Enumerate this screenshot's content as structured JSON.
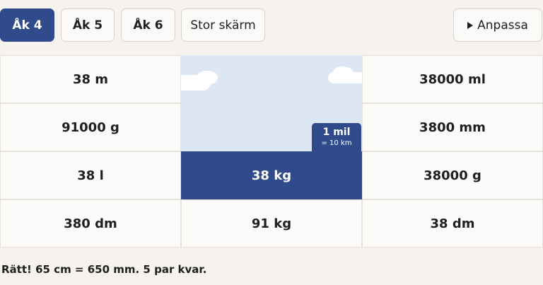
{
  "toolbar": {
    "grades": [
      {
        "label": "Åk 4",
        "active": true
      },
      {
        "label": "Åk 5",
        "active": false
      },
      {
        "label": "Åk 6",
        "active": false
      }
    ],
    "big_screen_label": "Stor skärm",
    "customize_label": "Anpassa"
  },
  "grid": {
    "col1": [
      "38 m",
      "91000 g",
      "38 l",
      "380 dm"
    ],
    "col2_filled": "38 kg",
    "col2_bottom": "91 kg",
    "col3": [
      "38000 ml",
      "3800 mm",
      "38000 g",
      "38 dm"
    ]
  },
  "hint": {
    "main": "1 mil",
    "sub": "= 10 km"
  },
  "status": "Rätt! 65 cm = 650 mm. 5 par kvar.",
  "colors": {
    "accent": "#2f4b8c",
    "sky": "#dde6f3",
    "background": "#f6f3ee"
  }
}
